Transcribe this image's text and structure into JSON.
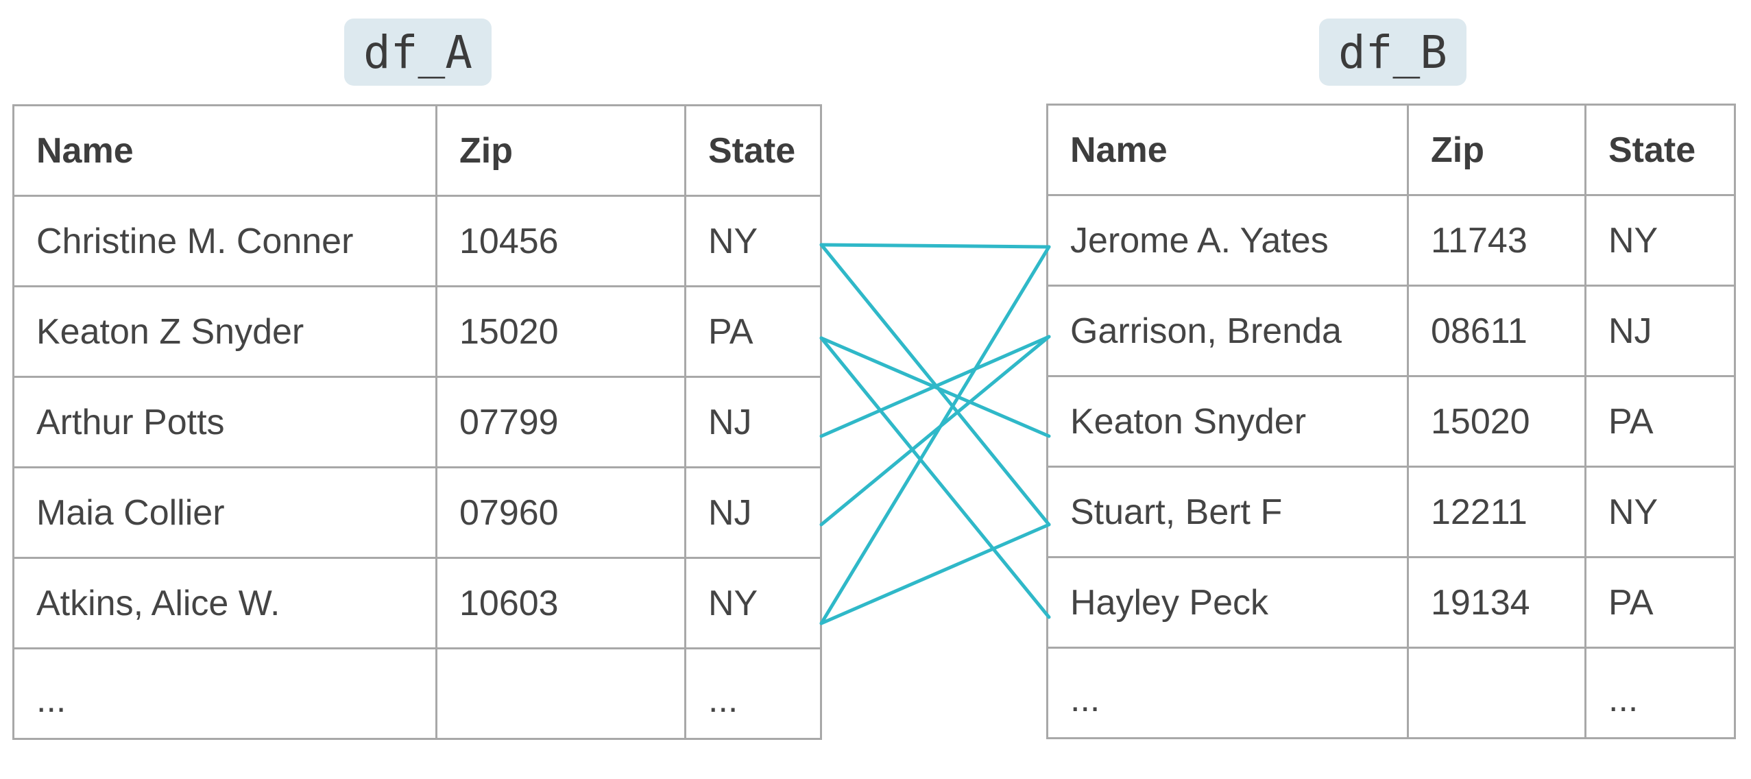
{
  "left": {
    "label": "df_A",
    "columns": [
      "Name",
      "Zip",
      "State"
    ],
    "rows": [
      [
        "Christine M. Conner",
        "10456",
        "NY"
      ],
      [
        "Keaton Z Snyder",
        "15020",
        "PA"
      ],
      [
        "Arthur Potts",
        "07799",
        "NJ"
      ],
      [
        "Maia Collier",
        "07960",
        "NJ"
      ],
      [
        "Atkins, Alice W.",
        "10603",
        "NY"
      ],
      [
        "...",
        "",
        "..."
      ]
    ]
  },
  "right": {
    "label": "df_B",
    "columns": [
      "Name",
      "Zip",
      "State"
    ],
    "rows": [
      [
        "Jerome A. Yates",
        "11743",
        "NY"
      ],
      [
        "Garrison, Brenda",
        "08611",
        "NJ"
      ],
      [
        "Keaton Snyder",
        "15020",
        "PA"
      ],
      [
        "Stuart, Bert F",
        "12211",
        "NY"
      ],
      [
        "Hayley Peck",
        "19134",
        "PA"
      ],
      [
        "...",
        "",
        "..."
      ]
    ]
  },
  "links": [
    {
      "from_row": 0,
      "to_row": 0
    },
    {
      "from_row": 0,
      "to_row": 3
    },
    {
      "from_row": 1,
      "to_row": 2
    },
    {
      "from_row": 1,
      "to_row": 4
    },
    {
      "from_row": 2,
      "to_row": 1
    },
    {
      "from_row": 3,
      "to_row": 1
    },
    {
      "from_row": 4,
      "to_row": 0
    },
    {
      "from_row": 4,
      "to_row": 3
    }
  ],
  "link_color": "#2fb8c8",
  "border_color": "#a8a8a8"
}
